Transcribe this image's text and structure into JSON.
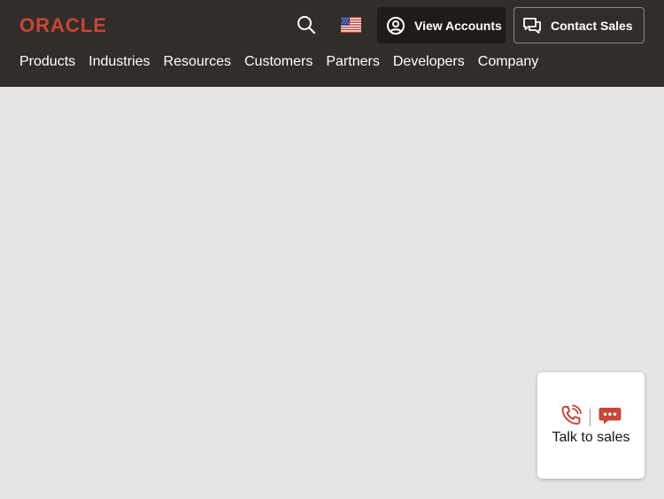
{
  "brand": {
    "logo_text": "ORACLE",
    "color": "#c74634"
  },
  "header": {
    "search_icon": "search-icon",
    "locale_icon": "us-flag-icon",
    "view_accounts": {
      "label": "View Accounts",
      "icon": "user-circle-icon"
    },
    "contact_sales": {
      "label": "Contact Sales",
      "icon": "chat-bubble-icon"
    }
  },
  "nav": {
    "items": [
      "Products",
      "Industries",
      "Resources",
      "Customers",
      "Partners",
      "Developers",
      "Company"
    ]
  },
  "chat_widget": {
    "label": "Talk to sales",
    "icons": [
      "phone-icon",
      "chat-icon"
    ]
  },
  "colors": {
    "header_bg": "#312d2a",
    "accent": "#c74634",
    "page_bg": "#e5e5e5"
  }
}
